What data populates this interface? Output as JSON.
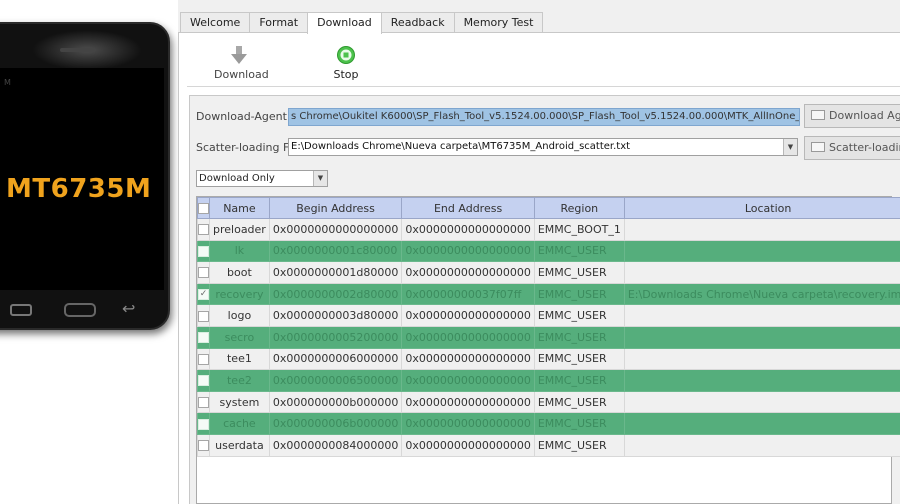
{
  "phone": {
    "screen_tag": "M",
    "chip_label": "MT6735M"
  },
  "tabs": [
    {
      "label": "Welcome"
    },
    {
      "label": "Format"
    },
    {
      "label": "Download"
    },
    {
      "label": "Readback"
    },
    {
      "label": "Memory Test"
    }
  ],
  "toolbar": {
    "download_label": "Download",
    "stop_label": "Stop"
  },
  "form": {
    "download_agent_label": "Download-Agent",
    "download_agent_value": "s Chrome\\Oukitel K6000\\SP_Flash_Tool_v5.1524.00.000\\SP_Flash_Tool_v5.1524.00.000\\MTK_AllInOne_DA.bin",
    "download_agent_button": "Download Agent",
    "scatter_label": "Scatter-loading File",
    "scatter_value": "E:\\Downloads Chrome\\Nueva carpeta\\MT6735M_Android_scatter.txt",
    "scatter_button": "Scatter-loading",
    "mode_value": "Download Only"
  },
  "table": {
    "headers": {
      "name": "Name",
      "begin": "Begin Address",
      "end": "End Address",
      "region": "Region",
      "location": "Location"
    },
    "rows": [
      {
        "checked": false,
        "name": "preloader",
        "begin": "0x0000000000000000",
        "end": "0x0000000000000000",
        "region": "EMMC_BOOT_1",
        "location": ""
      },
      {
        "checked": false,
        "name": "lk",
        "begin": "0x0000000001c80000",
        "end": "0x0000000000000000",
        "region": "EMMC_USER",
        "location": ""
      },
      {
        "checked": false,
        "name": "boot",
        "begin": "0x0000000001d80000",
        "end": "0x0000000000000000",
        "region": "EMMC_USER",
        "location": ""
      },
      {
        "checked": true,
        "name": "recovery",
        "begin": "0x0000000002d80000",
        "end": "0x00000000037f07ff",
        "region": "EMMC_USER",
        "location": "E:\\Downloads Chrome\\Nueva carpeta\\recovery.img"
      },
      {
        "checked": false,
        "name": "logo",
        "begin": "0x0000000003d80000",
        "end": "0x0000000000000000",
        "region": "EMMC_USER",
        "location": ""
      },
      {
        "checked": false,
        "name": "secro",
        "begin": "0x0000000005200000",
        "end": "0x0000000000000000",
        "region": "EMMC_USER",
        "location": ""
      },
      {
        "checked": false,
        "name": "tee1",
        "begin": "0x0000000006000000",
        "end": "0x0000000000000000",
        "region": "EMMC_USER",
        "location": ""
      },
      {
        "checked": false,
        "name": "tee2",
        "begin": "0x0000000006500000",
        "end": "0x0000000000000000",
        "region": "EMMC_USER",
        "location": ""
      },
      {
        "checked": false,
        "name": "system",
        "begin": "0x000000000b000000",
        "end": "0x0000000000000000",
        "region": "EMMC_USER",
        "location": ""
      },
      {
        "checked": false,
        "name": "cache",
        "begin": "0x000000006b000000",
        "end": "0x0000000000000000",
        "region": "EMMC_USER",
        "location": ""
      },
      {
        "checked": false,
        "name": "userdata",
        "begin": "0x0000000084000000",
        "end": "0x0000000000000000",
        "region": "EMMC_USER",
        "location": ""
      }
    ]
  },
  "colors": {
    "row_green": "#55ae7c",
    "header_blue": "#c5d1f0",
    "selection_blue": "#9fc3e4",
    "chip_orange": "#f0a31d",
    "stop_green": "#4cc24c"
  }
}
